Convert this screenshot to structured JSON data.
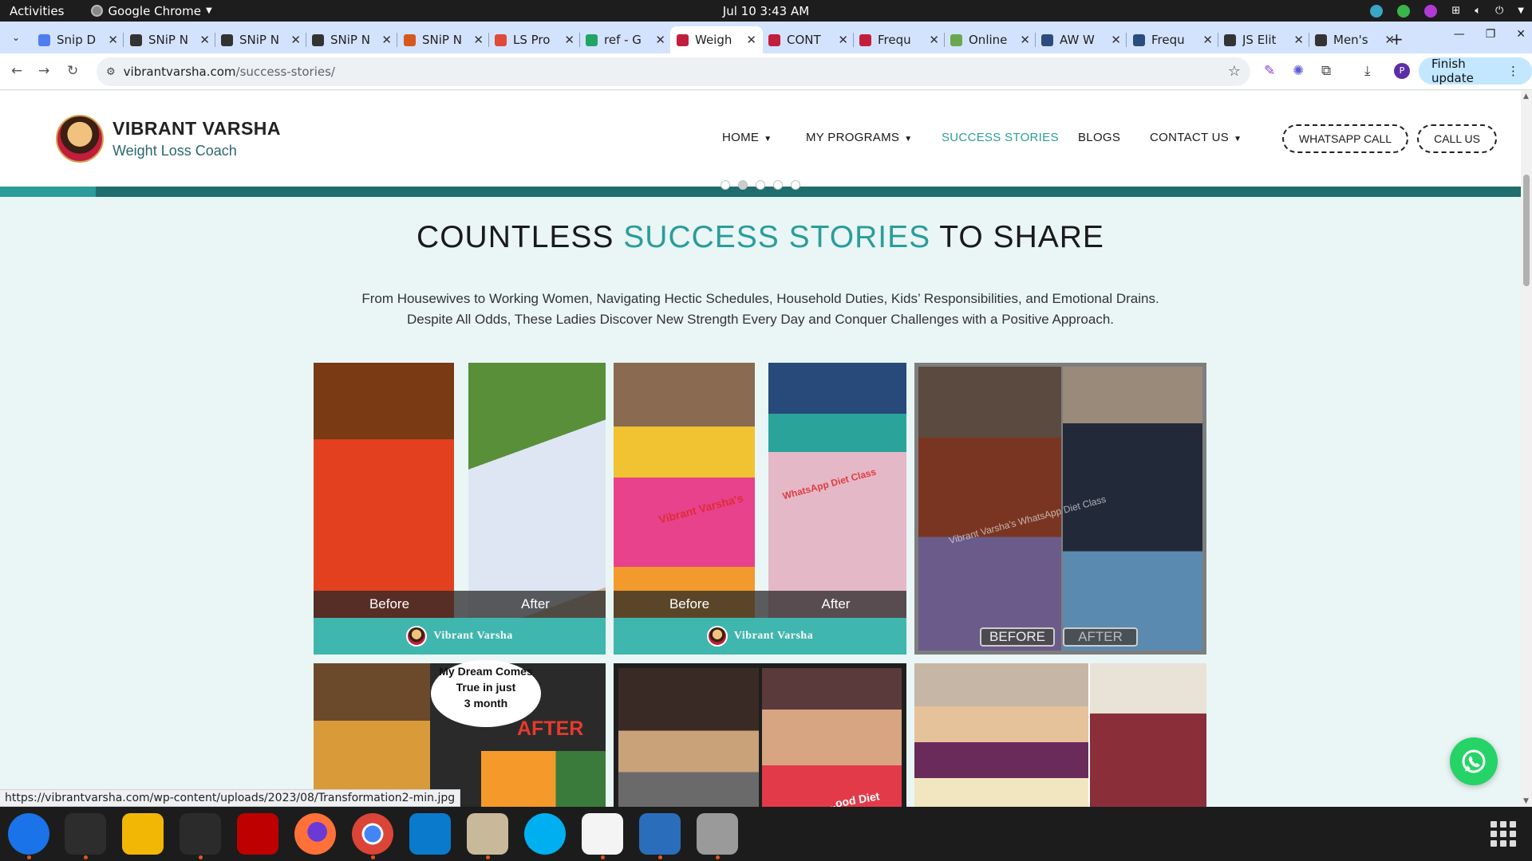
{
  "gnome": {
    "activities": "Activities",
    "app_name": "Google Chrome",
    "clock": "Jul 10  3:43 AM"
  },
  "tabs": [
    {
      "label": "Snip D",
      "favicon_color": "#4f7df1"
    },
    {
      "label": "SNiP N",
      "favicon_color": "#333333"
    },
    {
      "label": "SNiP N",
      "favicon_color": "#333333"
    },
    {
      "label": "SNiP N",
      "favicon_color": "#333333"
    },
    {
      "label": "SNiP N",
      "favicon_color": "#d8561f"
    },
    {
      "label": "LS Pro",
      "favicon_color": "#e04a3a"
    },
    {
      "label": "ref - G",
      "favicon_color": "#21a464"
    },
    {
      "label": "Weigh",
      "favicon_color": "#c21d3c"
    },
    {
      "label": "CONT",
      "favicon_color": "#c21d3c"
    },
    {
      "label": "Frequ",
      "favicon_color": "#c21d3c"
    },
    {
      "label": "Online",
      "favicon_color": "#6aa84f"
    },
    {
      "label": "AW W",
      "favicon_color": "#2b4c7e"
    },
    {
      "label": "Frequ",
      "favicon_color": "#2b4c7e"
    },
    {
      "label": "JS Elit",
      "favicon_color": "#333333"
    },
    {
      "label": "Men's",
      "favicon_color": "#333333"
    }
  ],
  "active_tab_index": 7,
  "toolbar": {
    "url_domain": "vibrantvarsha.com",
    "url_path": "/success-stories/",
    "profile_initial": "P",
    "finish_update": "Finish update"
  },
  "site": {
    "brand_name": "VIBRANT VARSHA",
    "brand_sub": "Weight Loss Coach",
    "nav": {
      "home": "HOME",
      "programs": "MY PROGRAMS",
      "stories": "SUCCESS STORIES",
      "blogs": "BLOGS",
      "contact": "CONTACT US"
    },
    "whatsapp_call": "WHATSAPP CALL",
    "call_us": "CALL US",
    "accent_color": "#2a9d9b"
  },
  "headline": {
    "part1": "COUNTLESS ",
    "part2": "SUCCESS STORIES",
    "part3": " TO SHARE"
  },
  "intro": {
    "line1": "From Housewives to Working Women, Navigating Hectic Schedules, Household Duties, Kids’ Responsibilities, and Emotional Drains.",
    "line2": "Despite All Odds, These Ladies Discover New Strength Every Day and Conquer Challenges with a Positive Approach."
  },
  "gallery": {
    "before": "Before",
    "after": "After",
    "vv_brand": "Vibrant Varsha",
    "watermark1": "Vibrant Varsha's",
    "watermark2": "WhatsApp Diet Class",
    "watermark3": "Vibrant Varsha's WhatsApp Diet Class",
    "before_caps": "BEFORE",
    "after_caps": "AFTER",
    "dream_line1": "My Dream Comes",
    "dream_line2": "True in just",
    "dream_line3": "3 month",
    "after_red": "AFTER",
    "diet_wm": "...ood Diet"
  },
  "status_url": "https://vibrantvarsha.com/wp-content/uploads/2023/08/Transformation2-min.jpg",
  "dock": [
    {
      "name": "thunderbird",
      "color": "#1a73e8"
    },
    {
      "name": "terminal",
      "color": "#2d2d2d"
    },
    {
      "name": "calculator",
      "color": "#f2b705"
    },
    {
      "name": "system-monitor",
      "color": "#2b2b2b"
    },
    {
      "name": "filezilla",
      "color": "#bf0000"
    },
    {
      "name": "firefox",
      "color": "#ff7139"
    },
    {
      "name": "chrome",
      "color": "#4285f4"
    },
    {
      "name": "vscode",
      "color": "#0a7acc"
    },
    {
      "name": "files",
      "color": "#c8b99a"
    },
    {
      "name": "skype",
      "color": "#00aff0"
    },
    {
      "name": "text-editor",
      "color": "#f4f4f4"
    },
    {
      "name": "libreoffice-writer",
      "color": "#2a6ebb"
    },
    {
      "name": "disks",
      "color": "#9a9a9a"
    }
  ]
}
